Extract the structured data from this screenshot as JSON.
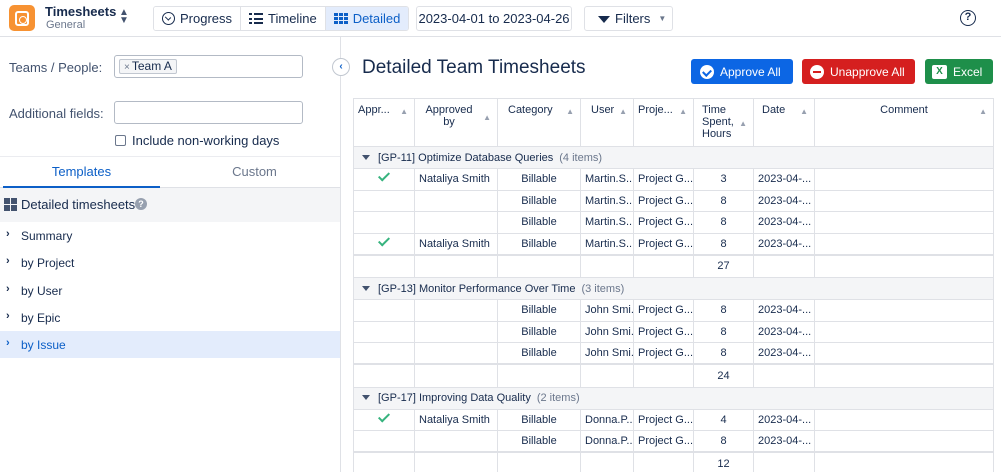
{
  "app": {
    "title": "Timesheets",
    "subtitle": "General"
  },
  "views": [
    {
      "label": "Progress",
      "icon": "clock-icon",
      "active": false
    },
    {
      "label": "Timeline",
      "icon": "list-icon",
      "active": false
    },
    {
      "label": "Detailed",
      "icon": "grid-icon",
      "active": true
    }
  ],
  "date_range": "2023-04-01 to 2023-04-26",
  "filters_label": "Filters",
  "help_label": "?",
  "left": {
    "teams_label": "Teams / People:",
    "teams_chip": "Team A",
    "additional_label": "Additional fields:",
    "include_nonworking": "Include non-working days",
    "tabs": [
      "Templates",
      "Custom"
    ],
    "template_header": "Detailed timesheets",
    "nav": [
      "Summary",
      "by Project",
      "by User",
      "by Epic",
      "by Issue"
    ],
    "selected_nav": "by Issue"
  },
  "main": {
    "title": "Detailed Team Timesheets",
    "approve_all": "Approve All",
    "unapprove_all": "Unapprove All",
    "excel": "Excel"
  },
  "table": {
    "headers": {
      "approved": "Appr...",
      "approved_by": "Approved by",
      "category": "Category",
      "user": "User",
      "project": "Proje...",
      "time": "Time Spent, Hours",
      "date": "Date",
      "comment": "Comment"
    },
    "groups": [
      {
        "title": "[GP-11] Optimize Database Queries",
        "count": "(4 items)",
        "rows": [
          {
            "approved": true,
            "approved_by": "Nataliya Smith",
            "category": "Billable",
            "user": "Martin.S...",
            "project": "Project G...",
            "hours": "3",
            "date": "2023-04-...",
            "comment": ""
          },
          {
            "approved": false,
            "approved_by": "",
            "category": "Billable",
            "user": "Martin.S...",
            "project": "Project G...",
            "hours": "8",
            "date": "2023-04-...",
            "comment": ""
          },
          {
            "approved": false,
            "approved_by": "",
            "category": "Billable",
            "user": "Martin.S...",
            "project": "Project G...",
            "hours": "8",
            "date": "2023-04-...",
            "comment": ""
          },
          {
            "approved": true,
            "approved_by": "Nataliya Smith",
            "category": "Billable",
            "user": "Martin.S...",
            "project": "Project G...",
            "hours": "8",
            "date": "2023-04-...",
            "comment": ""
          }
        ],
        "total": "27"
      },
      {
        "title": "[GP-13] Monitor Performance Over Time",
        "count": "(3 items)",
        "rows": [
          {
            "approved": false,
            "approved_by": "",
            "category": "Billable",
            "user": "John Smi...",
            "project": "Project G...",
            "hours": "8",
            "date": "2023-04-...",
            "comment": ""
          },
          {
            "approved": false,
            "approved_by": "",
            "category": "Billable",
            "user": "John Smi...",
            "project": "Project G...",
            "hours": "8",
            "date": "2023-04-...",
            "comment": ""
          },
          {
            "approved": false,
            "approved_by": "",
            "category": "Billable",
            "user": "John Smi...",
            "project": "Project G...",
            "hours": "8",
            "date": "2023-04-...",
            "comment": ""
          }
        ],
        "total": "24"
      },
      {
        "title": "[GP-17] Improving Data Quality",
        "count": "(2 items)",
        "rows": [
          {
            "approved": true,
            "approved_by": "Nataliya Smith",
            "category": "Billable",
            "user": "Donna.P...",
            "project": "Project G...",
            "hours": "4",
            "date": "2023-04-...",
            "comment": ""
          },
          {
            "approved": false,
            "approved_by": "",
            "category": "Billable",
            "user": "Donna.P...",
            "project": "Project G...",
            "hours": "8",
            "date": "2023-04-...",
            "comment": ""
          }
        ],
        "total": "12"
      }
    ]
  },
  "colors": {
    "accent": "#0c66e4",
    "danger": "#d51f1f",
    "excel": "#1e8f4a",
    "approved_check": "#36b37e",
    "brand": "#f79232"
  }
}
